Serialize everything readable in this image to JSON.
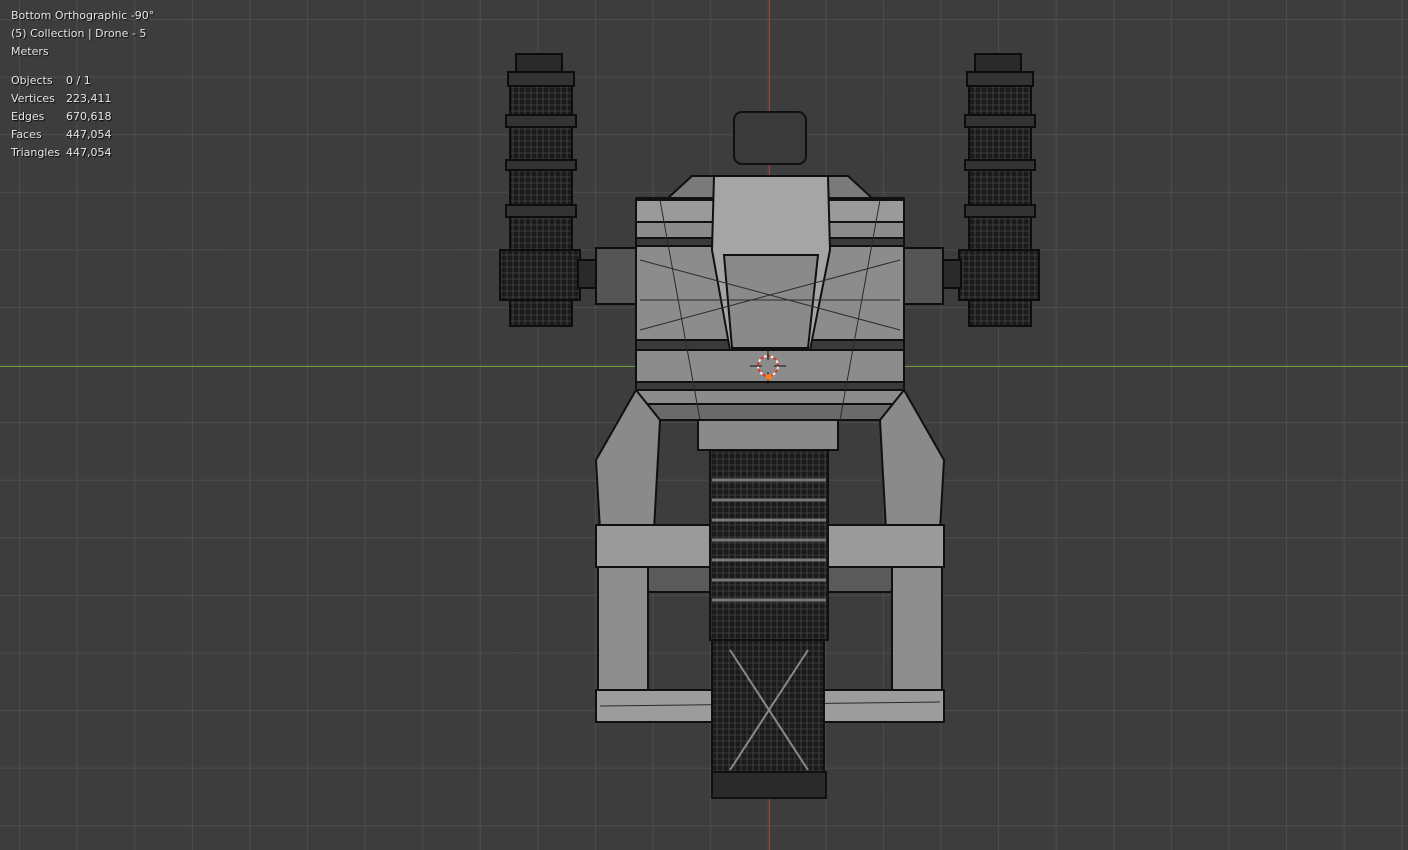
{
  "viewport": {
    "view_name": "Bottom Orthographic -90°",
    "collection_line": "(5) Collection | Drone - 5",
    "units": "Meters"
  },
  "stats": [
    {
      "label": "Objects",
      "value": "0 / 1"
    },
    {
      "label": "Vertices",
      "value": "223,411"
    },
    {
      "label": "Edges",
      "value": "670,618"
    },
    {
      "label": "Faces",
      "value": "447,054"
    },
    {
      "label": "Triangles",
      "value": "447,054"
    }
  ],
  "colors": {
    "background": "#3d3d3d",
    "grid": "#5a5a5a",
    "x_axis": "#6e9a3c",
    "y_axis": "#a33a3a",
    "mesh_fill": "#8c8c8c",
    "mesh_wire": "#111111"
  }
}
